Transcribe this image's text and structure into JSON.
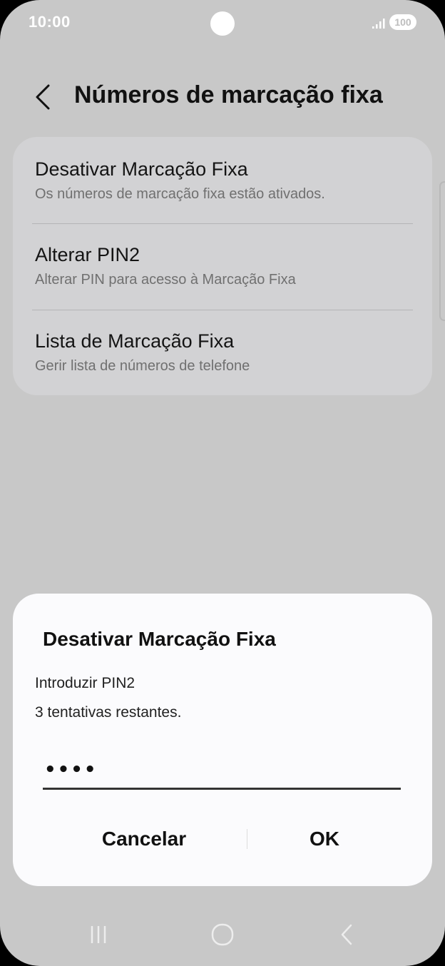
{
  "status_bar": {
    "time": "10:00",
    "battery": "100"
  },
  "header": {
    "title": "Números de marcação fixa"
  },
  "settings": {
    "items": [
      {
        "title": "Desativar Marcação Fixa",
        "subtitle": "Os números de marcação fixa estão ativados."
      },
      {
        "title": "Alterar PIN2",
        "subtitle": "Alterar PIN para acesso à Marcação Fixa"
      },
      {
        "title": "Lista de Marcação Fixa",
        "subtitle": "Gerir lista de números de telefone"
      }
    ]
  },
  "dialog": {
    "title": "Desativar Marcação Fixa",
    "message_line1": "Introduzir PIN2",
    "message_line2": "3 tentativas restantes.",
    "pin_value": "••••",
    "cancel_label": "Cancelar",
    "ok_label": "OK"
  },
  "nav": {
    "icons": [
      "recent-apps-icon",
      "home-icon",
      "back-icon"
    ]
  },
  "colors": {
    "background": "#c8c8c8",
    "card": "#d2d2d4",
    "dialog": "#fbfbfd"
  }
}
